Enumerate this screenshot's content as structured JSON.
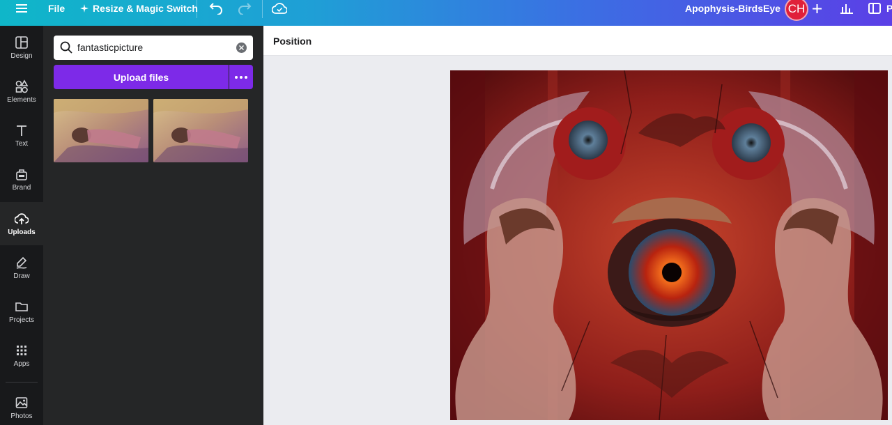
{
  "topbar": {
    "file_label": "File",
    "resize_label": "Resize & Magic Switch",
    "doc_title": "Apophysis-BirdsEye",
    "avatar_initials": "CH",
    "present_label": "P"
  },
  "rail": {
    "items": [
      {
        "label": "Design",
        "icon": "design-icon"
      },
      {
        "label": "Elements",
        "icon": "elements-icon"
      },
      {
        "label": "Text",
        "icon": "text-icon"
      },
      {
        "label": "Brand",
        "icon": "brand-icon"
      },
      {
        "label": "Uploads",
        "icon": "uploads-icon",
        "active": true
      },
      {
        "label": "Draw",
        "icon": "draw-icon"
      },
      {
        "label": "Projects",
        "icon": "projects-icon"
      },
      {
        "label": "Apps",
        "icon": "apps-icon"
      },
      {
        "label": "Photos",
        "icon": "photos-icon"
      }
    ]
  },
  "panel": {
    "search_value": "fantasticpicture",
    "upload_label": "Upload files"
  },
  "toolbar": {
    "position_label": "Position"
  },
  "colors": {
    "accent": "#7d2ae8",
    "rail_bg": "#18191b",
    "panel_bg": "#252627",
    "avatar": "#e0203a"
  }
}
